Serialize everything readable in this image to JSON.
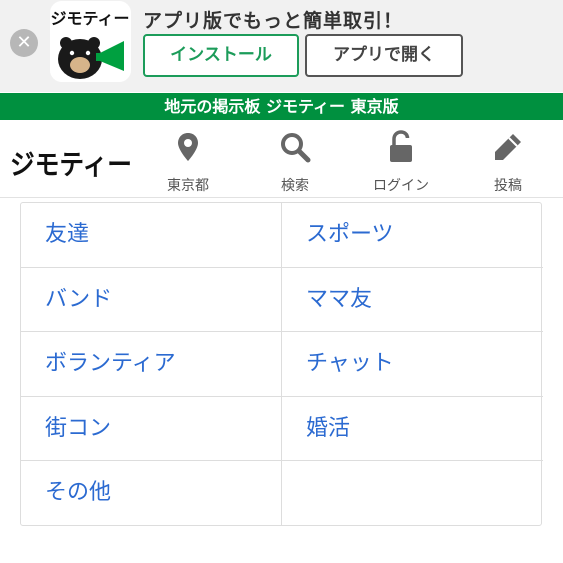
{
  "app_banner": {
    "close_symbol": "✕",
    "icon_name": "jmty-app-icon",
    "title": "アプリ版でもっと簡単取引！",
    "install_label": "インストール",
    "open_label": "アプリで開く",
    "icon_text": "ジモティー"
  },
  "site_strip": {
    "text": "地元の掲示板 ジモティー 東京版",
    "color": "#00903f"
  },
  "header": {
    "logo_text": "ジモティー",
    "nav": [
      {
        "label": "東京都",
        "icon": "map-pin-icon"
      },
      {
        "label": "検索",
        "icon": "search-icon"
      },
      {
        "label": "ログイン",
        "icon": "unlock-icon"
      },
      {
        "label": "投稿",
        "icon": "pencil-icon"
      }
    ]
  },
  "categories": [
    {
      "label": "友達"
    },
    {
      "label": "スポーツ"
    },
    {
      "label": "バンド"
    },
    {
      "label": "ママ友"
    },
    {
      "label": "ボランティア"
    },
    {
      "label": "チャット"
    },
    {
      "label": "街コン"
    },
    {
      "label": "婚活"
    },
    {
      "label": "その他"
    },
    {
      "label": ""
    }
  ],
  "colors": {
    "brand_green": "#00903f",
    "install_green": "#1c9c5a",
    "link_blue": "#2b6ad1",
    "icon_gray": "#666666"
  }
}
